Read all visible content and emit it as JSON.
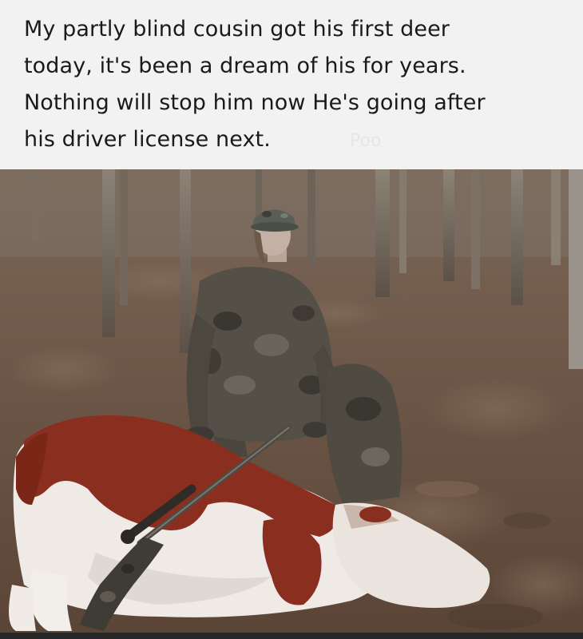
{
  "caption": {
    "line1": "My partly blind cousin got his first deer",
    "line2": "today, it's been a dream of his for years.",
    "line3": "Nothing will stop him now  He's going after",
    "line4": "his driver license next."
  },
  "watermark": "Poo",
  "photo": {
    "subject_hunter": "hunter-figure",
    "subject_animal": "cow",
    "subject_rifle": "rifle"
  },
  "colors": {
    "background": "#f2f2f2",
    "text": "#1a1a1a",
    "forest_floor": "#6b5546",
    "cow_red": "#8a2e1f",
    "cow_white": "#efeae6",
    "camo": "#4f4b42"
  }
}
